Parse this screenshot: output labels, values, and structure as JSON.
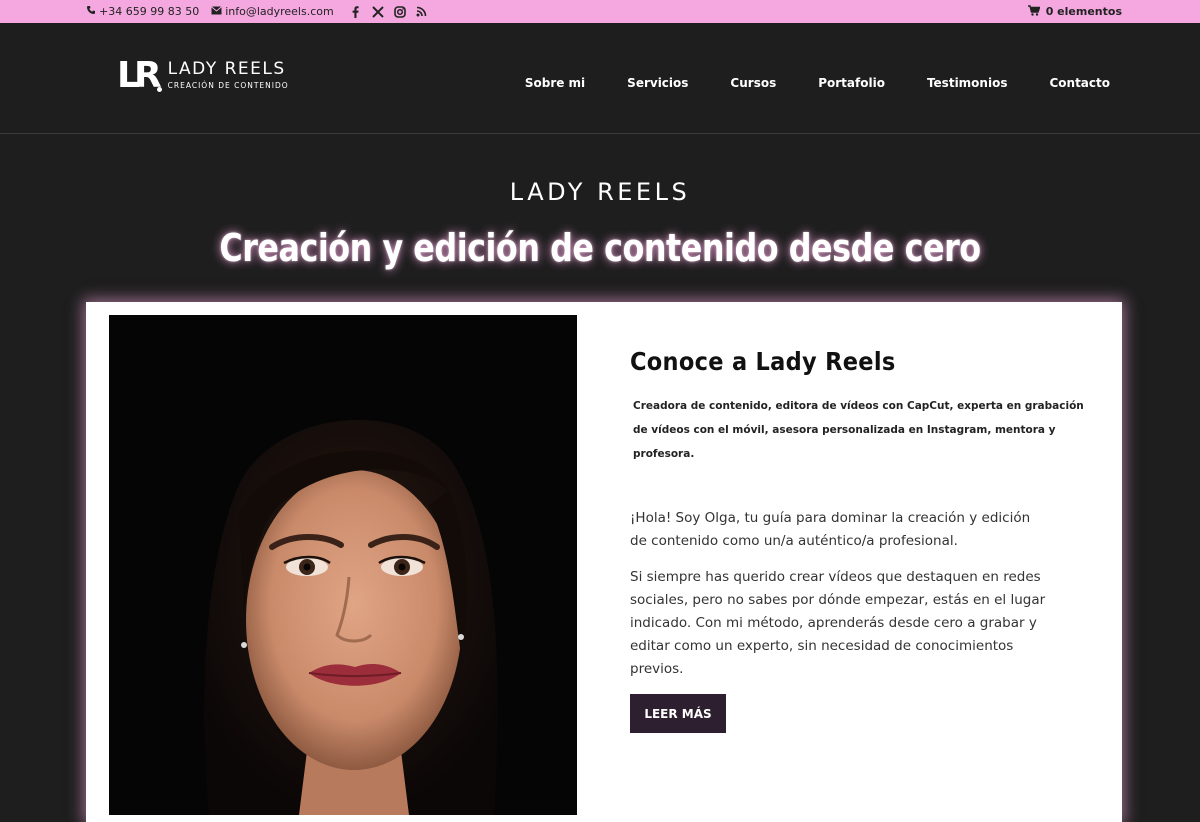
{
  "topbar": {
    "phone": "+34 659 99 83 50",
    "email": "info@ladyreels.com",
    "social": [
      "facebook-icon",
      "x-icon",
      "instagram-icon",
      "rss-icon"
    ],
    "cart": "0 elementos"
  },
  "header": {
    "logo_mark": "LR",
    "logo_name": "LADY REELS",
    "logo_tagline": "CREACIÓN DE CONTENIDO",
    "nav": [
      "Sobre mi",
      "Servicios",
      "Cursos",
      "Portafolio",
      "Testimonios",
      "Contacto"
    ]
  },
  "hero": {
    "brand": "LADY REELS",
    "headline": "Creación y edición de contenido desde cero"
  },
  "about": {
    "title": "Conoce a Lady Reels",
    "subtitle": "Creadora de contenido, editora de vídeos con CapCut, experta en grabación de vídeos con el móvil, asesora personalizada en Instagram, mentora y profesora.",
    "paragraph1": "¡Hola! Soy Olga, tu guía para dominar la creación y edición de contenido como un/a auténtico/a profesional.",
    "paragraph2": "Si siempre has querido crear vídeos que destaquen en redes sociales, pero no sabes por dónde empezar, estás en el lugar indicado. Con mi método, aprenderás desde cero a grabar y editar como un experto, sin necesidad de conocimientos previos.",
    "button": "LEER MÁS"
  },
  "colors": {
    "topbar": "#f5a8e0",
    "background": "#1e1e1e",
    "button": "#2d1f2f"
  }
}
